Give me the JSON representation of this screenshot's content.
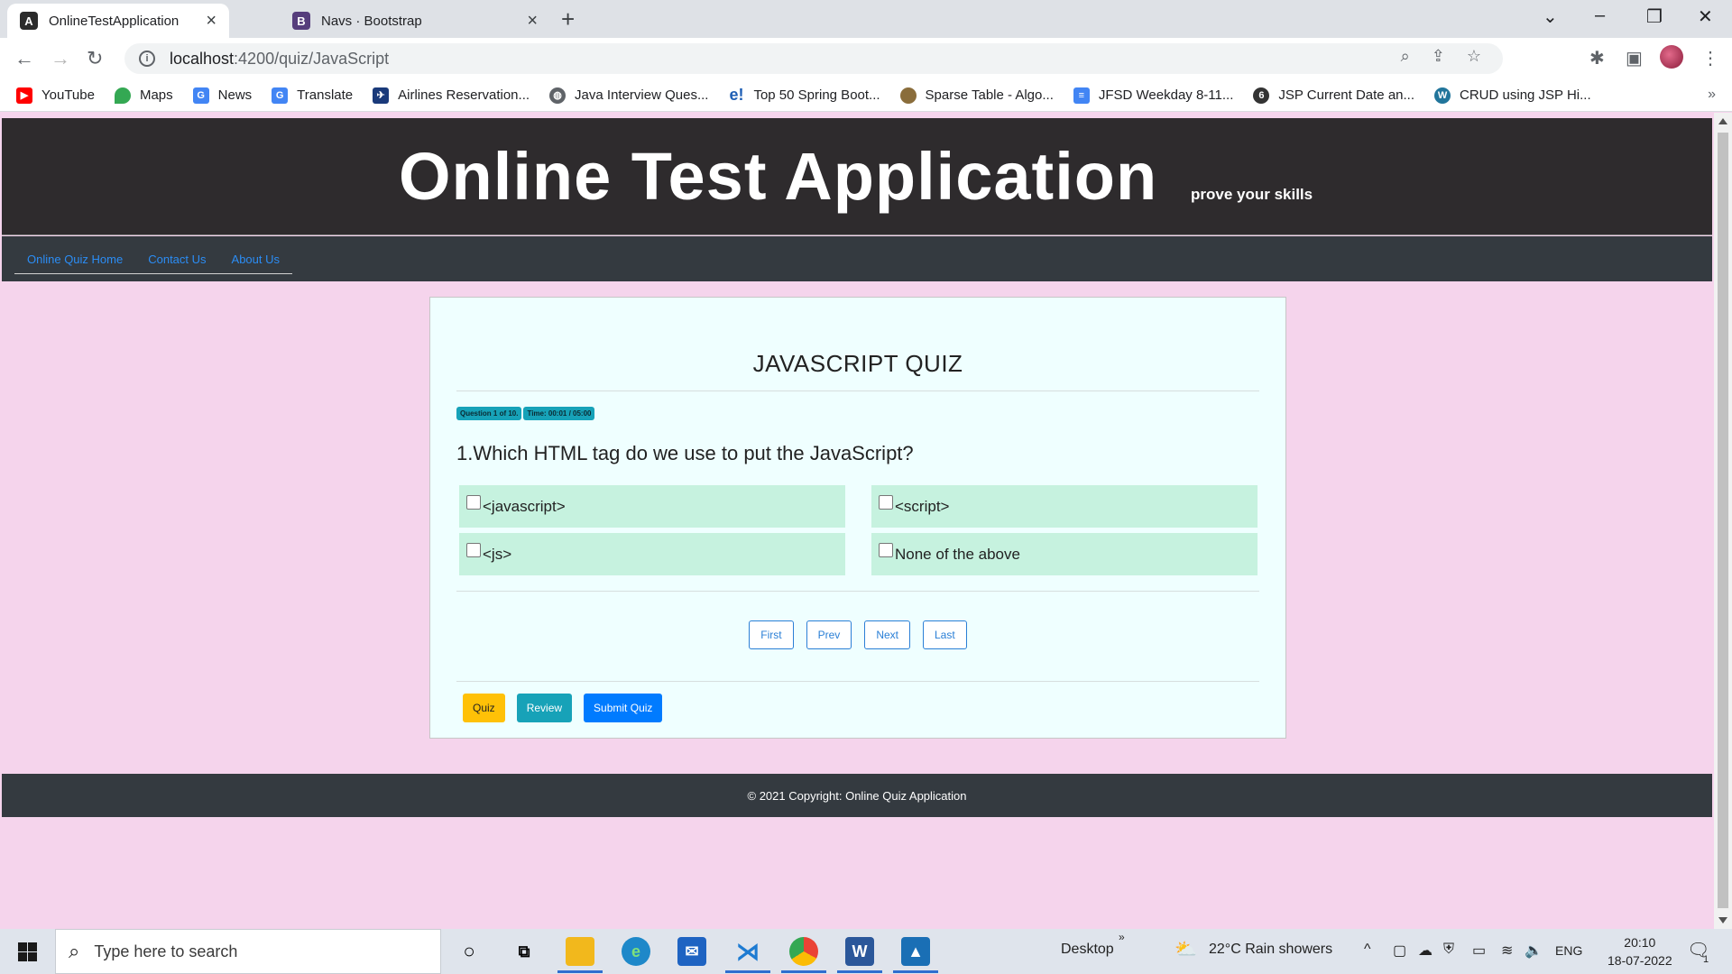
{
  "browser": {
    "tabs": [
      {
        "title": "OnlineTestApplication",
        "icon": "angular-icon",
        "active": true
      },
      {
        "title": "Navs · Bootstrap",
        "icon": "bootstrap-icon",
        "active": false
      }
    ],
    "url_host": "localhost",
    "url_path": ":4200/quiz/JavaScript",
    "bookmarks": [
      {
        "label": "YouTube",
        "icon": "youtube-icon",
        "color": "#ff0000"
      },
      {
        "label": "Maps",
        "icon": "maps-icon",
        "color": "#34a853"
      },
      {
        "label": "News",
        "icon": "news-icon",
        "color": "#4285f4"
      },
      {
        "label": "Translate",
        "icon": "translate-icon",
        "color": "#4285f4"
      },
      {
        "label": "Airlines Reservation...",
        "icon": "airplane-icon",
        "color": "#1a3a7a"
      },
      {
        "label": "Java Interview Ques...",
        "icon": "globe-icon",
        "color": "#5f6368"
      },
      {
        "label": "Top 50 Spring Boot...",
        "icon": "edureka-icon",
        "color": "#1f5fb5"
      },
      {
        "label": "Sparse Table - Algo...",
        "icon": "site-icon",
        "color": "#8a6d3b"
      },
      {
        "label": "JFSD Weekday 8-11...",
        "icon": "docs-icon",
        "color": "#4285f4"
      },
      {
        "label": "JSP Current Date an...",
        "icon": "site-icon",
        "color": "#333333"
      },
      {
        "label": "CRUD using JSP Hi...",
        "icon": "wordpress-icon",
        "color": "#21759b"
      }
    ]
  },
  "app": {
    "title": "Online Test Application",
    "tagline": "prove your skills",
    "nav": [
      "Online Quiz Home",
      "Contact Us",
      "About Us"
    ],
    "footer": "© 2021 Copyright: Online Quiz Application"
  },
  "quiz": {
    "title": "JAVASCRIPT QUIZ",
    "badge_question": "Question 1 of 10.",
    "badge_time": "Time: 00:01 / 05:00",
    "question": "1.Which HTML tag do we use to put the JavaScript?",
    "options": [
      "<javascript>",
      "<script>",
      "<js>",
      "None of the above"
    ],
    "pager": [
      "First",
      "Prev",
      "Next",
      "Last"
    ],
    "actions": [
      "Quiz",
      "Review",
      "Submit Quiz"
    ]
  },
  "taskbar": {
    "search_placeholder": "Type here to search",
    "desktop_label": "Desktop",
    "weather": "22°C  Rain showers",
    "language": "ENG",
    "time": "20:10",
    "date": "18-07-2022",
    "notification_count": "1"
  },
  "colors": {
    "page_bg": "#f5d4ec",
    "header_bg": "#2e2b2d",
    "nav_bg": "#343a40",
    "card_bg": "#efffff",
    "option_bg": "#c6f2df",
    "accent_blue": "#007bff",
    "accent_teal": "#17a2b8",
    "accent_yellow": "#ffc107"
  }
}
